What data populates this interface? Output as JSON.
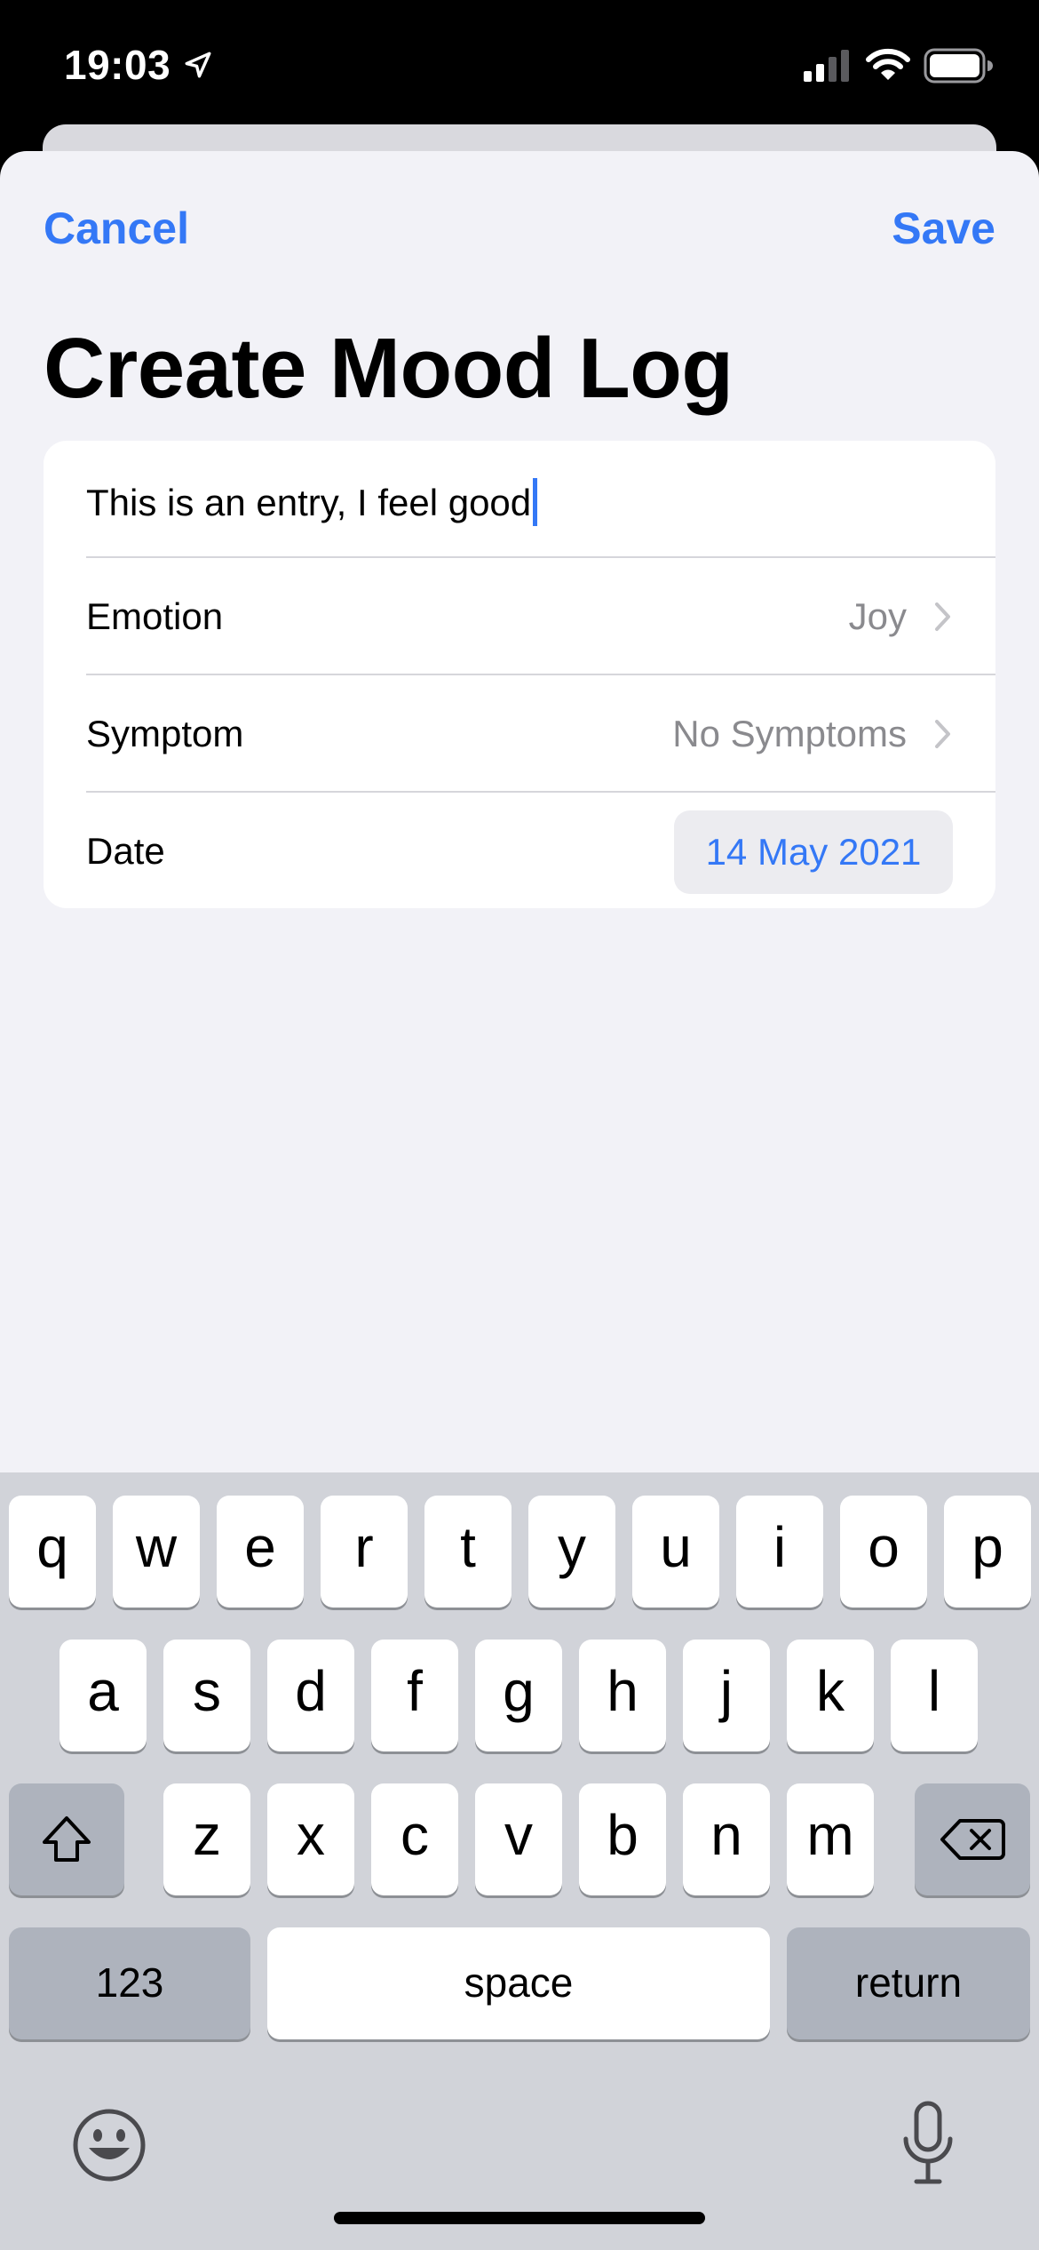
{
  "status_bar": {
    "time": "19:03"
  },
  "nav": {
    "cancel_label": "Cancel",
    "save_label": "Save"
  },
  "page": {
    "title": "Create Mood Log"
  },
  "form": {
    "entry_text": "This is an entry, I feel good",
    "emotion": {
      "label": "Emotion",
      "value": "Joy"
    },
    "symptom": {
      "label": "Symptom",
      "value": "No Symptoms"
    },
    "date": {
      "label": "Date",
      "value": "14 May 2021"
    }
  },
  "keyboard": {
    "row1": [
      "q",
      "w",
      "e",
      "r",
      "t",
      "y",
      "u",
      "i",
      "o",
      "p"
    ],
    "row2": [
      "a",
      "s",
      "d",
      "f",
      "g",
      "h",
      "j",
      "k",
      "l"
    ],
    "row3": [
      "z",
      "x",
      "c",
      "v",
      "b",
      "n",
      "m"
    ],
    "numbers_label": "123",
    "space_label": "space",
    "return_label": "return",
    "icons": [
      "shift-icon",
      "delete-icon",
      "emoji-icon",
      "microphone-icon"
    ]
  },
  "colors": {
    "accent": "#3478f6",
    "background": "#f2f2f7",
    "keyboard": "#d1d3d9"
  }
}
